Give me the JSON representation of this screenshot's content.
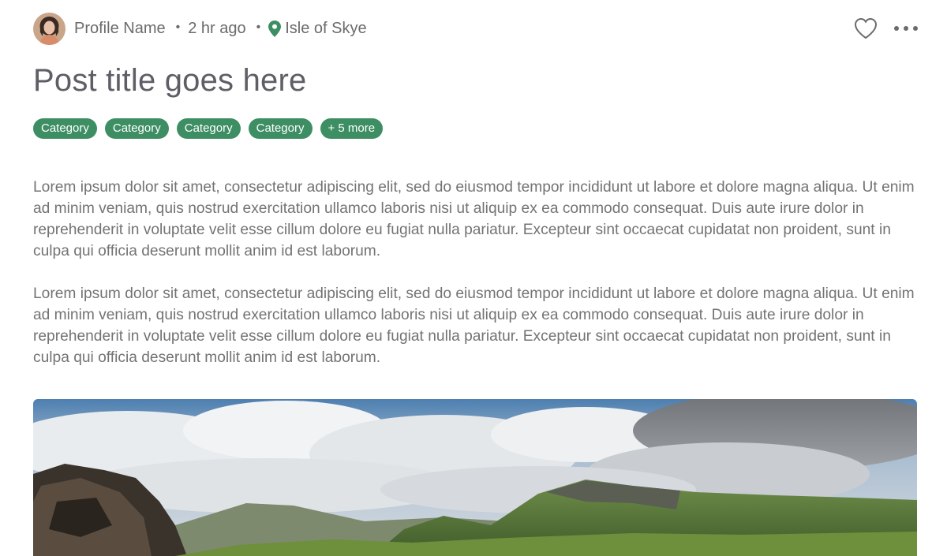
{
  "post": {
    "profile_name": "Profile Name",
    "separator": "•",
    "time_ago": "2 hr ago",
    "location": "Isle of Skye",
    "title": "Post title goes here",
    "tags": [
      "Category",
      "Category",
      "Category",
      "Category",
      "+ 5 more"
    ],
    "paragraphs": [
      "Lorem ipsum dolor sit amet, consectetur adipiscing elit, sed do eiusmod tempor incididunt ut labore et dolore magna aliqua. Ut enim ad minim veniam, quis nostrud exercitation ullamco laboris nisi ut aliquip ex ea commodo consequat. Duis aute irure dolor in reprehenderit in voluptate velit esse cillum dolore eu fugiat nulla pariatur. Excepteur sint occaecat cupidatat non proident, sunt in culpa qui officia deserunt mollit anim id est laborum.",
      "Lorem ipsum dolor sit amet, consectetur adipiscing elit, sed do eiusmod tempor incididunt ut labore et dolore magna aliqua. Ut enim ad minim veniam, quis nostrud exercitation ullamco laboris nisi ut aliquip ex ea commodo consequat. Duis aute irure dolor in reprehenderit in voluptate velit esse cillum dolore eu fugiat nulla pariatur. Excepteur sint occaecat cupidatat non proident, sunt in culpa qui officia deserunt mollit anim id est laborum."
    ]
  },
  "icons": {
    "avatar": "avatar",
    "location": "map-pin-icon",
    "like": "heart-outline-icon",
    "more": "more-horizontal-icon"
  },
  "colors": {
    "accent": "#3e8e63",
    "text": "#737373",
    "title": "#5e5e66"
  }
}
